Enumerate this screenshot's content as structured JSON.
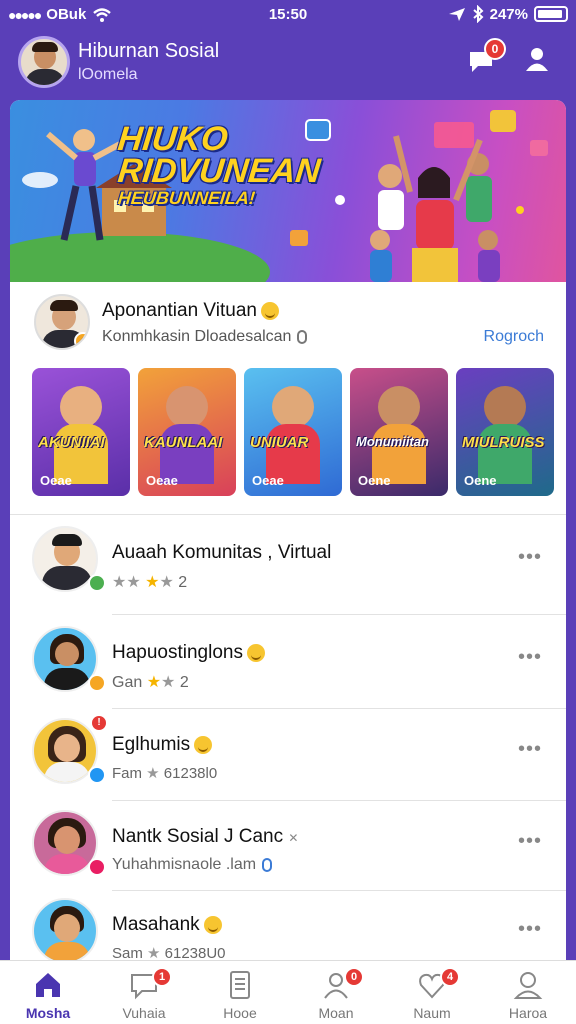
{
  "statusbar": {
    "carrier": "OBuk",
    "time": "15:50",
    "battery": "247%"
  },
  "header": {
    "title": "Hiburnan Sosial",
    "subtitle": "lOomela",
    "chat_badge": "0"
  },
  "banner": {
    "line1": "HIUKO",
    "line2": "RIDVUNEAN",
    "line3": "HEUBUNNEILA!"
  },
  "feature": {
    "title": "Aponantian Vituan",
    "subtitle": "Konmhkasin Dloadesalcan",
    "action": "Rogroch",
    "thumbs": [
      {
        "label": "AKUNIIAI",
        "footer": "Oeae",
        "bg": "#7a3fc0"
      },
      {
        "label": "KAUNLAAI",
        "footer": "Oeae",
        "bg": "#e8603a"
      },
      {
        "label": "UNIUAR",
        "footer": "Oeae",
        "bg": "#2f7fd4"
      },
      {
        "label": "Monumiitan",
        "footer": "Oene",
        "bg": "#a0347a"
      },
      {
        "label": "MIULRUISS",
        "footer": "Oene",
        "bg": "#1f6a8a"
      }
    ]
  },
  "list": [
    {
      "name": "Auaah Komunitas , Virtual",
      "meta": "2",
      "mini": "#4caf50"
    },
    {
      "name": "Hapuostinglons",
      "meta": "Gan",
      "meta2": "2",
      "mini": "#f5a623"
    },
    {
      "name": "Eglhumis",
      "meta": "Fam",
      "meta2": "61238l0",
      "mini": "#2196f3",
      "badge": true
    },
    {
      "name": "Nantk Sosial J Canc",
      "meta": "Yuhahmisnaole .lam",
      "mini": "#e91e63"
    },
    {
      "name": "Masahank",
      "meta": "Sam",
      "meta2": "61238U0",
      "mini": "#ff9800"
    }
  ],
  "tabs": [
    {
      "label": "Mosha",
      "icon": "home-icon",
      "active": true
    },
    {
      "label": "Vuhaia",
      "icon": "chat-icon",
      "badge": "1"
    },
    {
      "label": "Hooe",
      "icon": "document-icon"
    },
    {
      "label": "Moan",
      "icon": "people-icon",
      "badge": "0"
    },
    {
      "label": "Naum",
      "icon": "heart-icon",
      "badge": "4"
    },
    {
      "label": "Haroa",
      "icon": "profile-icon"
    }
  ],
  "colors": {
    "accent": "#4a35b0",
    "background": "#5a3fb8",
    "badge": "#e53935",
    "link": "#3b7bd6"
  }
}
